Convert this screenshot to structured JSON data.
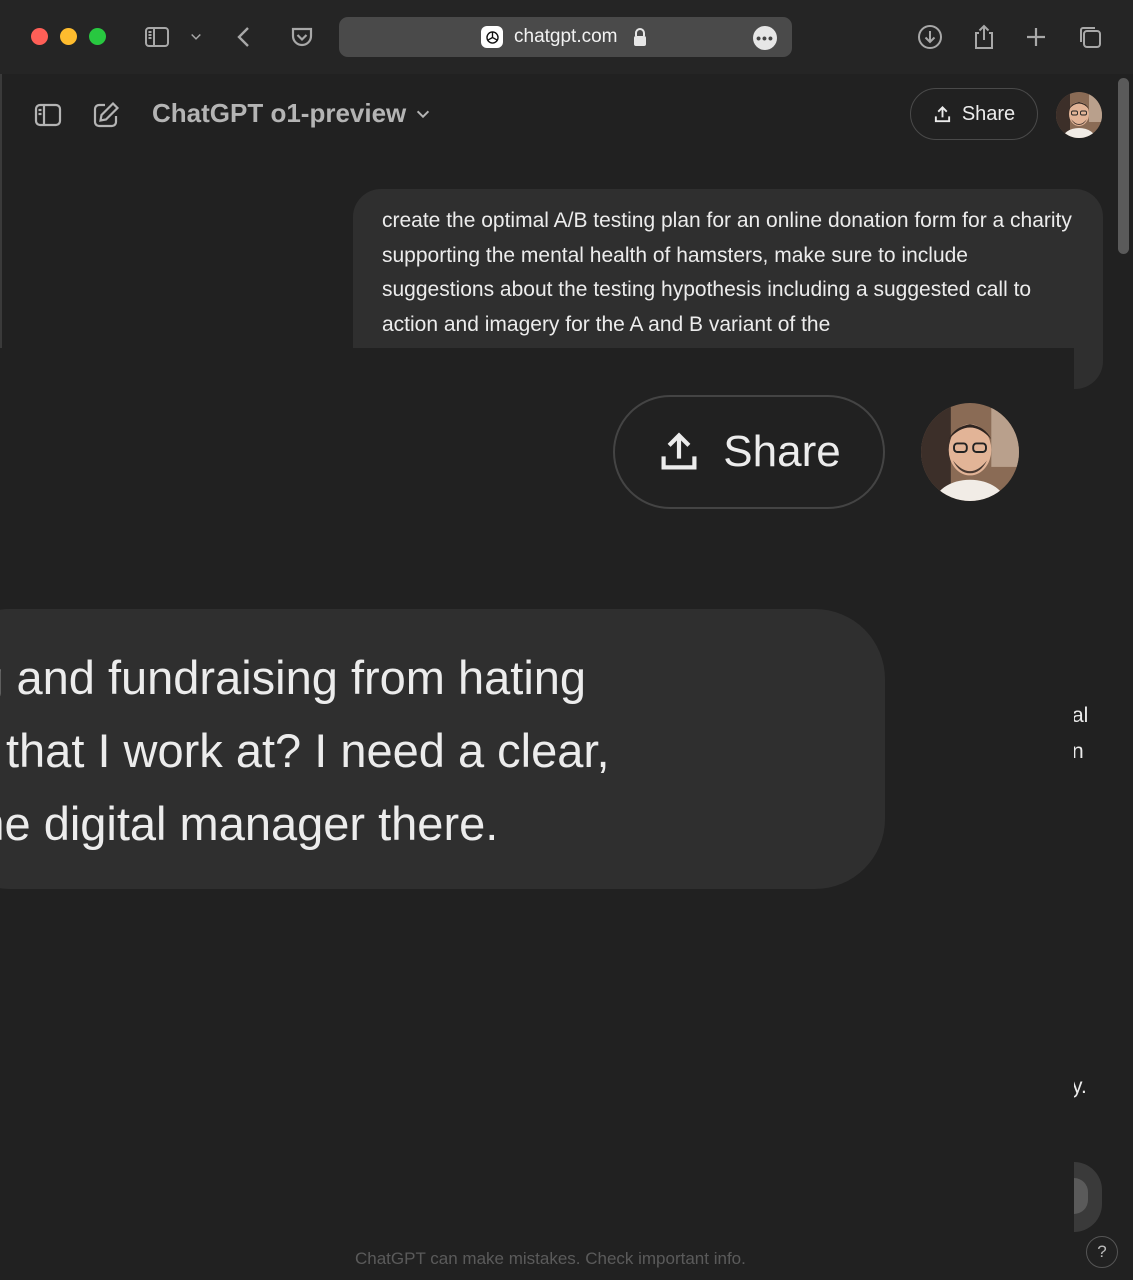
{
  "browser": {
    "url": "chatgpt.com",
    "colors": {
      "close": "#ff5f57",
      "minimize": "#febc2e",
      "zoom": "#28c840"
    },
    "icons": [
      "sidebar-icon",
      "chevron-down-icon",
      "back-icon",
      "pocket-icon",
      "lock-icon",
      "more-icon",
      "download-icon",
      "share-icon",
      "new-tab-icon",
      "tabs-overview-icon"
    ]
  },
  "header": {
    "model_title": "ChatGPT o1-preview",
    "share_label": "Share"
  },
  "conversation": {
    "user_message": "create the optimal A/B testing plan for an online donation form for a charity supporting the mental health of hamsters, make sure to include suggestions about the testing hypothesis including a suggested call to action and imagery for the A and B variant of the"
  },
  "zoom": {
    "share_label": "Share",
    "message_lines": [
      "keting and fundraising from hating",
      "harity that I work at? I need a clear,",
      " I'm the digital manager there."
    ]
  },
  "edge_fragments": {
    "a": "al",
    "b": "n",
    "c": "y."
  },
  "footer": {
    "disclaimer": "ChatGPT can make mistakes. Check important info.",
    "help": "?"
  }
}
